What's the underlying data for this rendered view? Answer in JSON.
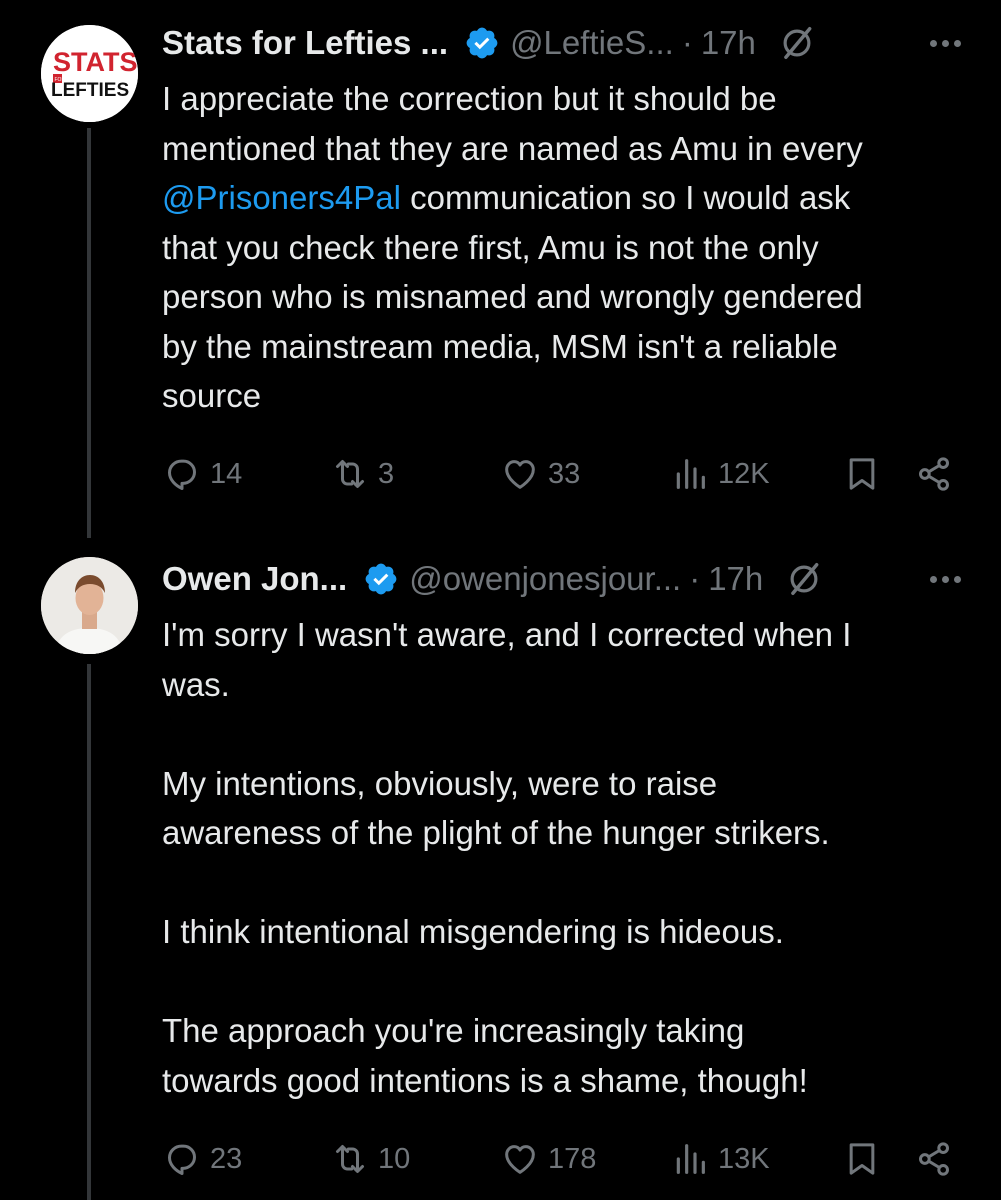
{
  "tweets": [
    {
      "author_name": "Stats for Lefties ...",
      "handle": "@LeftieS...",
      "dot": "·",
      "time": "17h",
      "avatar_logo_text": [
        "STATS",
        "FOR",
        "LEFTIES"
      ],
      "text_before": "I appreciate the correction but it should be\nmentioned that they are named as Amu in every\n",
      "mention": "@Prisoners4Pal",
      "text_after": " communication so I would ask\nthat you check there first, Amu is not the only\nperson who is misnamed and wrongly gendered\nby the mainstream media, MSM isn't a reliable\nsource",
      "replies": "14",
      "reposts": "3",
      "likes": "33",
      "views": "12K"
    },
    {
      "author_name": "Owen Jon...",
      "handle": "@owenjonesjour...",
      "dot": "·",
      "time": "17h",
      "text": "I'm sorry I wasn't aware, and I corrected when I\nwas.\n\nMy intentions, obviously, were to raise\nawareness of the plight of the hunger strikers.\n\nI think intentional misgendering is hideous.\n\nThe approach you're increasingly taking\ntowards good intentions is a shame, though!",
      "replies": "23",
      "reposts": "10",
      "likes": "178",
      "views": "13K"
    }
  ],
  "icons": {
    "verified": "verified-badge-icon",
    "grok": "grok-icon",
    "more": "more-icon",
    "reply": "reply-icon",
    "repost": "repost-icon",
    "like": "like-icon",
    "views": "views-icon",
    "bookmark": "bookmark-icon",
    "share": "share-icon"
  },
  "colors": {
    "background": "#000000",
    "text": "#e7e9ea",
    "muted": "#71767b",
    "link": "#1d9bf0",
    "verified": "#1d9bf0",
    "thread_line": "#333639",
    "logo_red": "#d1242f"
  }
}
